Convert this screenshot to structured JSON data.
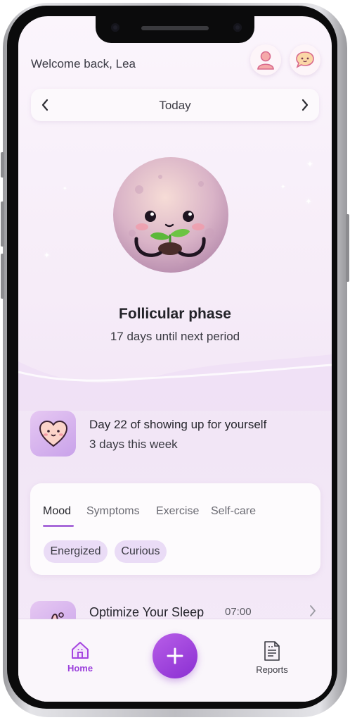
{
  "header": {
    "welcome": "Welcome back, Lea",
    "profile_icon": "user-icon",
    "chat_icon": "chat-bubble-icon"
  },
  "date_nav": {
    "label": "Today",
    "prev_icon": "chevron-left-icon",
    "next_icon": "chevron-right-icon"
  },
  "phase": {
    "title": "Follicular phase",
    "subtitle": "17 days until next period",
    "mascot_icon": "moon-sprout-mascot-icon"
  },
  "streak": {
    "title": "Day 22 of showing up for yourself",
    "subtitle": "3 days this week",
    "icon": "heart-face-icon"
  },
  "log_card": {
    "tabs": [
      {
        "label": "Mood",
        "active": true
      },
      {
        "label": "Symptoms",
        "active": false
      },
      {
        "label": "Exercise",
        "active": false
      },
      {
        "label": "Self-care",
        "active": false
      }
    ],
    "chips": [
      "Energized",
      "Curious"
    ]
  },
  "recommendation": {
    "title": "Optimize Your Sleep",
    "time": "07:00",
    "icon": "sleep-icon"
  },
  "bottom_nav": {
    "home_label": "Home",
    "reports_label": "Reports",
    "add_icon": "plus-icon"
  },
  "colors": {
    "accent": "#9b3fdc",
    "chip_bg": "#eadcf6",
    "background": "#f6ecf8"
  }
}
